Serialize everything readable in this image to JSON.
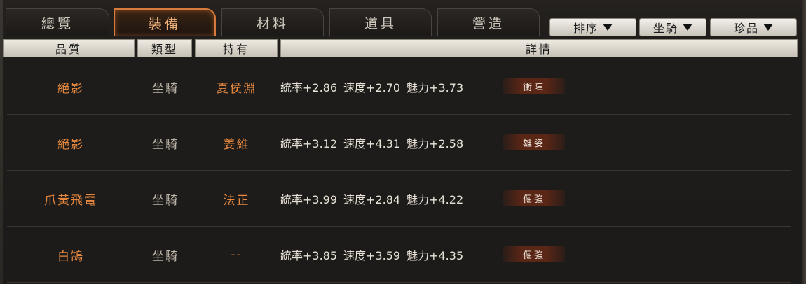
{
  "tabs": [
    {
      "label": "總覽"
    },
    {
      "label": "裝備"
    },
    {
      "label": "材料"
    },
    {
      "label": "道具"
    },
    {
      "label": "營造"
    }
  ],
  "active_tab": "裝備",
  "sort_buttons": [
    {
      "label": "排序"
    },
    {
      "label": "坐騎"
    },
    {
      "label": "珍品"
    }
  ],
  "columns": {
    "quality": "品質",
    "type": "類型",
    "owner": "持有",
    "detail": "詳情"
  },
  "rows": [
    {
      "name": "絕影",
      "type": "坐騎",
      "owner": "夏侯淵",
      "stats": [
        "統率+2.86",
        "速度+2.70",
        "魅力+3.73"
      ],
      "skill": "衝陣"
    },
    {
      "name": "絕影",
      "type": "坐騎",
      "owner": "姜維",
      "stats": [
        "統率+3.12",
        "速度+4.31",
        "魅力+2.58"
      ],
      "skill": "雄姿"
    },
    {
      "name": "爪黃飛電",
      "type": "坐騎",
      "owner": "法正",
      "stats": [
        "統率+3.99",
        "速度+2.84",
        "魅力+4.22"
      ],
      "skill": "倔強"
    },
    {
      "name": "白鵠",
      "type": "坐騎",
      "owner": "--",
      "stats": [
        "統率+3.85",
        "速度+3.59",
        "魅力+4.35"
      ],
      "skill": "倔強"
    }
  ],
  "colors": {
    "accent_orange": "#e8893f",
    "active_tab_border": "#d87a3a",
    "skill_badge": "#5a2616"
  }
}
